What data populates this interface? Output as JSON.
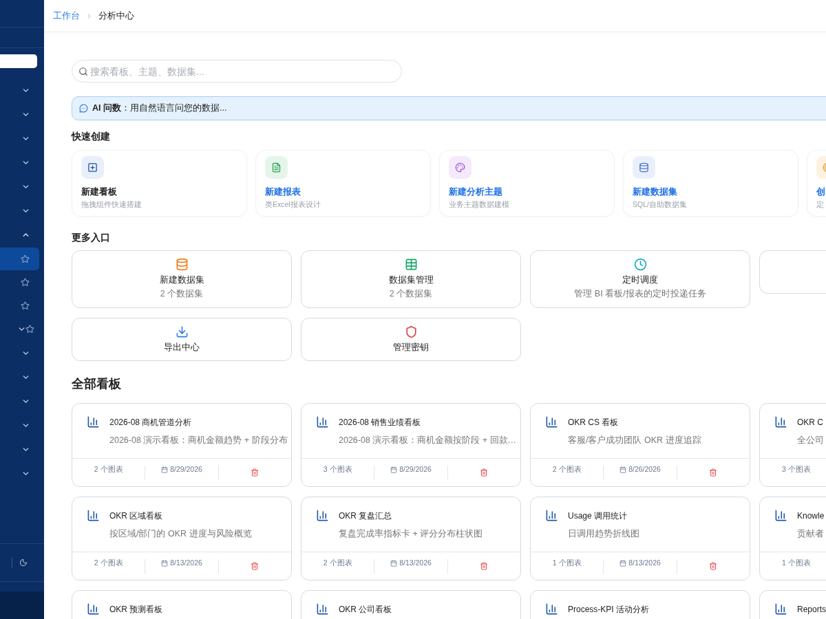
{
  "breadcrumb": [
    {
      "label": "工作台",
      "link": true
    },
    {
      "label": "分析中心",
      "link": false
    }
  ],
  "sidebar": {
    "search": {
      "kind": "field"
    },
    "items": [
      {
        "expanded": false
      },
      {
        "expanded": false
      },
      {
        "expanded": false
      },
      {
        "expanded": false
      },
      {
        "expanded": false
      },
      {
        "expanded": false
      },
      {
        "expanded": true,
        "children": [
          {
            "selected": true,
            "expandable": false
          },
          {
            "selected": false,
            "expandable": false
          },
          {
            "selected": false,
            "expandable": false
          },
          {
            "selected": false,
            "expandable": true
          }
        ]
      },
      {
        "expanded": false
      },
      {
        "expanded": false
      },
      {
        "expanded": false
      },
      {
        "expanded": false
      },
      {
        "expanded": false
      },
      {
        "expanded": false
      }
    ]
  },
  "search": {
    "placeholder": "搜索看板、主题、数据集..."
  },
  "ai_bar": {
    "label": "AI 问数",
    "text": "：用自然语言问您的数据..."
  },
  "quick_create": {
    "title": "快速创建",
    "items": [
      {
        "title": "新建看板",
        "subtitle": "拖拽组件快速搭建",
        "link": false
      },
      {
        "title": "新建报表",
        "subtitle": "类Excel报表设计",
        "link": true
      },
      {
        "title": "新建分析主题",
        "subtitle": "业务主题数据建模",
        "link": true
      },
      {
        "title": "新建数据集",
        "subtitle": "SQL/自助数据集",
        "link": true
      },
      {
        "title": "创",
        "subtitle": "定",
        "link": true
      }
    ]
  },
  "more": {
    "title": "更多入口",
    "items": [
      {
        "kind": "entry",
        "title": "新建数据集",
        "subtitle": "2 个数据集"
      },
      {
        "kind": "entry",
        "title": "数据集管理",
        "subtitle": "2 个数据集"
      },
      {
        "kind": "entry",
        "title": "定时调度",
        "subtitle": "管理 BI 看板/报表的定时投递任务"
      },
      {
        "kind": "clipped"
      },
      {
        "kind": "entry",
        "title": "导出中心"
      },
      {
        "kind": "entry",
        "title": "管理密钥"
      }
    ]
  },
  "boards": {
    "title": "全部看板",
    "items": [
      {
        "title": "2026-08 商机管道分析",
        "description": "2026-08 演示看板：商机金额趋势 + 阶段分布",
        "charts": "2 个图表",
        "date": "8/29/2026",
        "deletable": true
      },
      {
        "title": "2026-08 销售业绩看板",
        "description": "2026-08 演示看板：商机金额按阶段 + 回款…",
        "charts": "3 个图表",
        "date": "8/29/2026",
        "deletable": true
      },
      {
        "title": "OKR CS 看板",
        "description": "客服/客户成功团队 OKR 进度追踪",
        "charts": "2 个图表",
        "date": "8/26/2026",
        "deletable": true
      },
      {
        "title": "OKR C",
        "description": "全公司",
        "charts": "3 个图表"
      },
      {
        "title": "OKR 区域看板",
        "description": "按区域/部门的 OKR 进度与风险概览",
        "charts": "2 个图表",
        "date": "8/13/2026",
        "deletable": true
      },
      {
        "title": "OKR 复盘汇总",
        "description": "复盘完成率指标卡 + 评分分布柱状图",
        "charts": "2 个图表",
        "date": "8/13/2026",
        "deletable": true
      },
      {
        "title": "Usage 调用统计",
        "description": "日调用趋势折线图",
        "charts": "1 个图表",
        "date": "8/13/2026",
        "deletable": true
      },
      {
        "title": "Knowle",
        "description": "贡献者",
        "charts": "1 个图表"
      },
      {
        "title": "OKR 预测看板"
      },
      {
        "title": "OKR 公司看板"
      },
      {
        "title": "Process-KPI 活动分析"
      },
      {
        "title": "Reports"
      }
    ]
  }
}
